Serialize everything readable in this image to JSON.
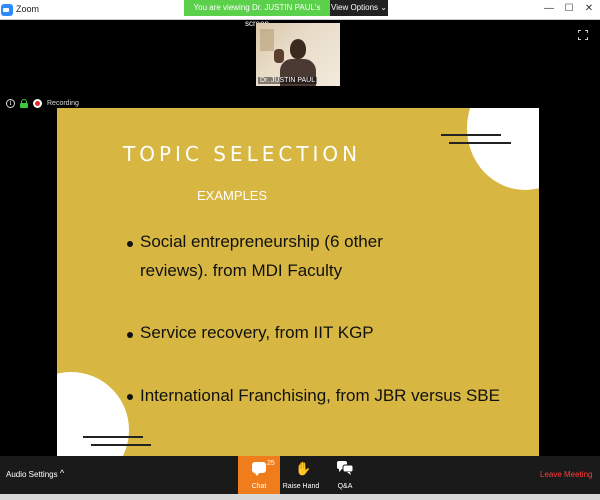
{
  "window": {
    "app_title": "Zoom",
    "minimize": "—",
    "maximize": "☐",
    "close": "✕"
  },
  "share_banner": {
    "viewing_label": "You are viewing Dr. JUSTIN PAUL's screen",
    "view_options_label": "View Options ⌄"
  },
  "video": {
    "participant_name": "Dr. JUSTIN PAUL"
  },
  "status": {
    "info_glyph": "i",
    "recording_label": "Recording"
  },
  "slide": {
    "title": "TOPIC SELECTION",
    "subtitle": "EXAMPLES",
    "bullets": [
      {
        "line1": "Social entrepreneurship (6  other",
        "line2": "reviews).  from MDI Faculty"
      },
      {
        "line1": "Service recovery, from IIT KGP"
      },
      {
        "line1": "International Franchising, from JBR versus SBE"
      }
    ],
    "colors": {
      "background": "#d7b642",
      "circle": "#ffffff",
      "text": "#111111"
    }
  },
  "toolbar": {
    "audio_settings_label": "Audio Settings",
    "audio_caret": "^",
    "chat_label": "Chat",
    "chat_badge": "25",
    "raise_hand_label": "Raise Hand",
    "qa_label": "Q&A",
    "leave_label": "Leave Meeting"
  },
  "icons": {
    "hand": "✋"
  },
  "colors": {
    "chat_active": "#f07d1b",
    "banner_green": "#5bd04a",
    "leave_red": "#ff3b3b"
  }
}
